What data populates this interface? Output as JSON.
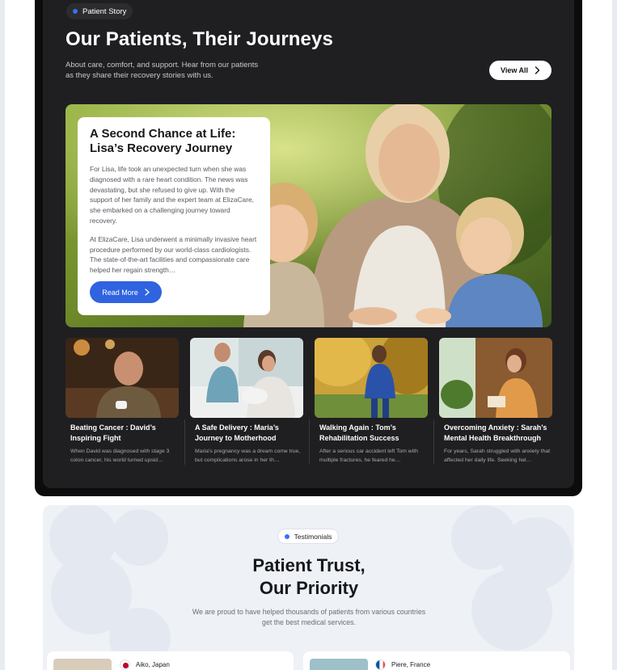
{
  "stories_section": {
    "badge": "Patient Story",
    "title": "Our Patients, Their Journeys",
    "subtitle": "About care, comfort, and support. Hear from our patients as they share their recovery stories with us.",
    "view_all": "View All",
    "featured": {
      "title": "A Second Chance at Life: Lisa’s Recovery Journey",
      "para1": "For Lisa, life took an unexpected turn when she was diagnosed with a rare heart condition. The news was devastating, but she refused to give up. With the support of her family and the expert team at ElizaCare, she embarked on a challenging journey toward recovery.",
      "para2": "At ElizaCare, Lisa underwent a minimally invasive heart procedure performed by our world-class cardiologists. The state-of-the-art facilities and compassionate care helped her regain strength…",
      "read_more": "Read More"
    },
    "stories": [
      {
        "title": "Beating Cancer : David’s Inspiring  Fight",
        "desc": "When David was diagnosed with stage 3 colon cancer, his world turned upsid…"
      },
      {
        "title": "A Safe Delivery : Maria’s Journey to Motherhood",
        "desc": "Maria’s pregnancy was a dream come true, but complications arose in her th…"
      },
      {
        "title": "Walking Again : Tom’s Rehabilitation Success",
        "desc": "After a serious car accident left Tom with multiple fractures, he feared he…"
      },
      {
        "title": "Overcoming Anxiety : Sarah’s Mental Health Breakthrough",
        "desc": "For years, Sarah struggled with anxiety that affected her daily life. Seeking hel…"
      }
    ]
  },
  "testimonials_section": {
    "badge": "Testimonials",
    "title_line1": "Patient Trust,",
    "title_line2": "Our Priority",
    "subtitle": "We are proud to have helped thousands of patients from various countries get the best medical services.",
    "cards": [
      {
        "location": "Aiko, Japan"
      },
      {
        "location": "Piere, France"
      }
    ]
  },
  "colors": {
    "accent": "#2f63e0",
    "dark_bg": "#1f1f21",
    "light_bg": "#eef1f6"
  },
  "icons": [
    "chevron-right-icon",
    "japan-flag-icon",
    "france-flag-icon"
  ]
}
